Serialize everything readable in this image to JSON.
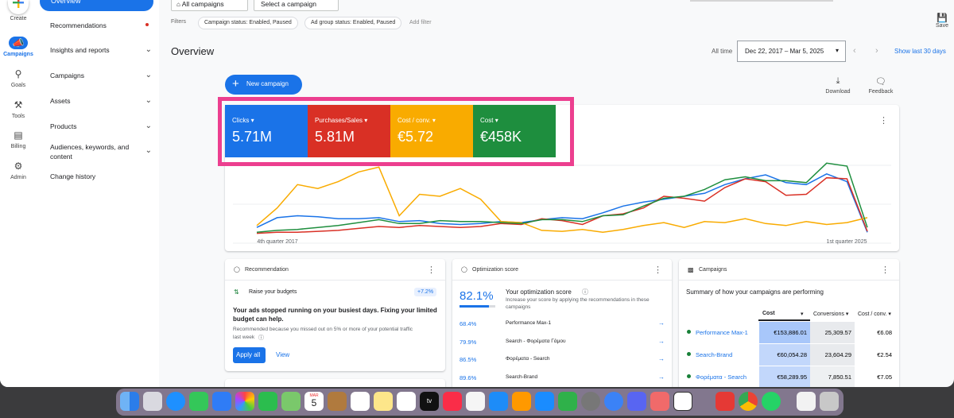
{
  "rail": {
    "create": "Create",
    "campaigns": "Campaigns",
    "goals": "Goals",
    "tools": "Tools",
    "billing": "Billing",
    "admin": "Admin"
  },
  "nav": {
    "overview": "Overview",
    "recommendations": "Recommendations",
    "insights": "Insights and reports",
    "campaigns": "Campaigns",
    "assets": "Assets",
    "products": "Products",
    "audiences_1": "Audiences, keywords, and",
    "audiences_2": "content",
    "change_history": "Change history"
  },
  "topbar": {
    "all_campaigns": "All campaigns",
    "select_campaign": "Select a campaign",
    "filters_label": "Filters",
    "chip_campaign_status": "Campaign status: Enabled, Paused",
    "chip_adgroup_status": "Ad group status: Enabled, Paused",
    "add_filter": "Add filter",
    "save": "Save"
  },
  "header": {
    "title": "Overview",
    "all_time": "All time",
    "date_range": "Dec 22, 2017 – Mar 5, 2025",
    "show_last_30": "Show last 30 days"
  },
  "actions": {
    "new_campaign": "New campaign",
    "download": "Download",
    "feedback": "Feedback"
  },
  "kpis": [
    {
      "name": "Clicks",
      "value": "5.71M",
      "color": "#1a73e8"
    },
    {
      "name": "Purchases/Sales",
      "value": "5.81M",
      "color": "#d93025"
    },
    {
      "name": "Cost / conv.",
      "value": "€5.72",
      "color": "#f9ab00"
    },
    {
      "name": "Cost",
      "value": "€458K",
      "color": "#1e8e3e"
    }
  ],
  "chart_data": {
    "type": "line",
    "x_tick_labels": [
      "4th quarter 2017",
      "1st quarter 2025"
    ],
    "series": [
      {
        "color": "#1a73e8",
        "values": [
          8,
          18,
          20,
          19,
          17,
          17,
          18,
          14,
          15,
          12,
          11,
          12,
          14,
          13,
          16,
          18,
          17,
          23,
          30,
          34,
          37,
          40,
          43,
          52,
          58,
          62,
          54,
          52,
          63,
          55,
          3
        ]
      },
      {
        "color": "#d93025",
        "values": [
          2,
          3,
          3,
          4,
          5,
          7,
          9,
          8,
          10,
          9,
          8,
          9,
          12,
          11,
          17,
          15,
          11,
          20,
          22,
          28,
          40,
          38,
          35,
          49,
          58,
          55,
          41,
          42,
          59,
          58,
          4
        ]
      },
      {
        "color": "#f9ab00",
        "values": [
          10,
          28,
          52,
          48,
          55,
          65,
          70,
          20,
          42,
          40,
          48,
          37,
          14,
          13,
          5,
          4,
          6,
          3,
          6,
          10,
          13,
          8,
          14,
          13,
          17,
          12,
          10,
          14,
          11,
          13,
          18
        ]
      },
      {
        "color": "#1e8e3e",
        "values": [
          3,
          5,
          6,
          8,
          10,
          13,
          16,
          12,
          12,
          15,
          14,
          14,
          13,
          12,
          16,
          16,
          14,
          20,
          21,
          30,
          38,
          40,
          47,
          57,
          60,
          56,
          56,
          54,
          74,
          71,
          8
        ]
      }
    ],
    "gridlines": true
  },
  "recommendation": {
    "header": "Recommendation",
    "item": "Raise your budgets",
    "badge": "+7.2%",
    "headline_1": "Your ads stopped running on your busiest days. Fixing your limited",
    "headline_2": "budget can help.",
    "detail_1": "Recommended because you missed out on 5% or more of your potential traffic",
    "detail_2": "last week",
    "apply_all": "Apply all",
    "view": "View"
  },
  "optimization": {
    "header": "Optimization score",
    "score": "82.1%",
    "score_fraction": 0.821,
    "title": "Your optimization score",
    "desc_1": "Increase your score by applying the recommendations in these",
    "desc_2": "campaigns",
    "rows": [
      {
        "score": "68.4%",
        "name": "Performance Max-1"
      },
      {
        "score": "79.9%",
        "name": "Search - Φορέματα Γάμου"
      },
      {
        "score": "86.5%",
        "name": "Φορέματα - Search"
      },
      {
        "score": "89.6%",
        "name": "Search-Brand"
      }
    ]
  },
  "campaigns_card": {
    "header": "Campaigns",
    "summary": "Summary of how your campaigns are performing",
    "col_cost": "Cost",
    "col_conversions": "Conversions",
    "col_cost_conv": "Cost / conv.",
    "rows": [
      {
        "name": "Performance Max-1",
        "cost": "€153,886.01",
        "conversions": "25,309.57",
        "cost_conv": "€6.08"
      },
      {
        "name": "Search-Brand",
        "cost": "€60,054.28",
        "conversions": "23,604.29",
        "cost_conv": "€2.54"
      },
      {
        "name": "Φορέματα - Search",
        "cost": "€58,289.95",
        "conversions": "7,850.51",
        "cost_conv": "€7.05"
      }
    ]
  },
  "dock": {
    "calendar_day": "5",
    "calendar_month": "MAR",
    "tv_label": "tv"
  }
}
